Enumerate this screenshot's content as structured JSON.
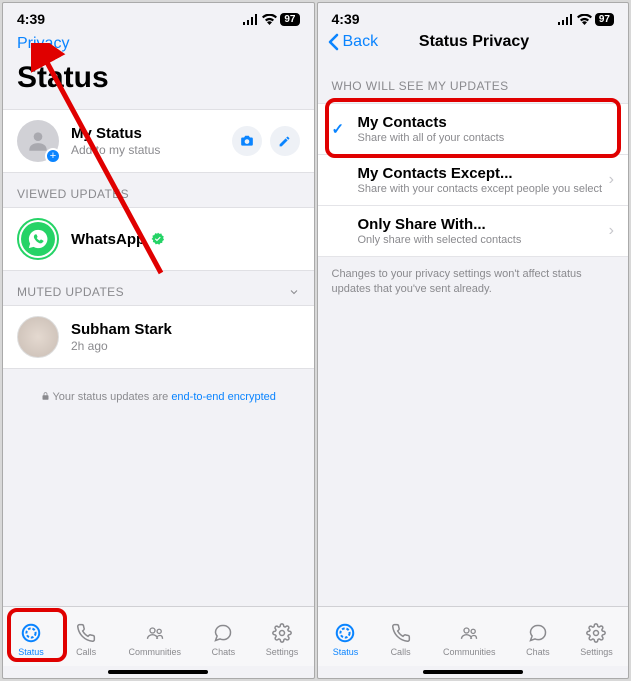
{
  "statusbar": {
    "time": "4:39",
    "battery": "97"
  },
  "left": {
    "privacy_link": "Privacy",
    "title": "Status",
    "my_status": {
      "title": "My Status",
      "sub": "Add to my status"
    },
    "sections": {
      "viewed": "VIEWED UPDATES",
      "muted": "MUTED UPDATES"
    },
    "viewed_item": {
      "name": "WhatsApp"
    },
    "muted_item": {
      "name": "Subham Stark",
      "time": "2h ago"
    },
    "footer_note_prefix": "Your status updates are ",
    "footer_note_link": "end-to-end encrypted"
  },
  "right": {
    "back": "Back",
    "title": "Status Privacy",
    "section_head": "WHO WILL SEE MY UPDATES",
    "options": [
      {
        "title": "My Contacts",
        "sub": "Share with all of your contacts",
        "selected": true
      },
      {
        "title": "My Contacts Except...",
        "sub": "Share with your contacts except people you select"
      },
      {
        "title": "Only Share With...",
        "sub": "Only share with selected contacts"
      }
    ],
    "note": "Changes to your privacy settings won't affect status updates that you've sent already."
  },
  "tabs": [
    {
      "label": "Status",
      "active": true
    },
    {
      "label": "Calls"
    },
    {
      "label": "Communities"
    },
    {
      "label": "Chats"
    },
    {
      "label": "Settings"
    }
  ]
}
